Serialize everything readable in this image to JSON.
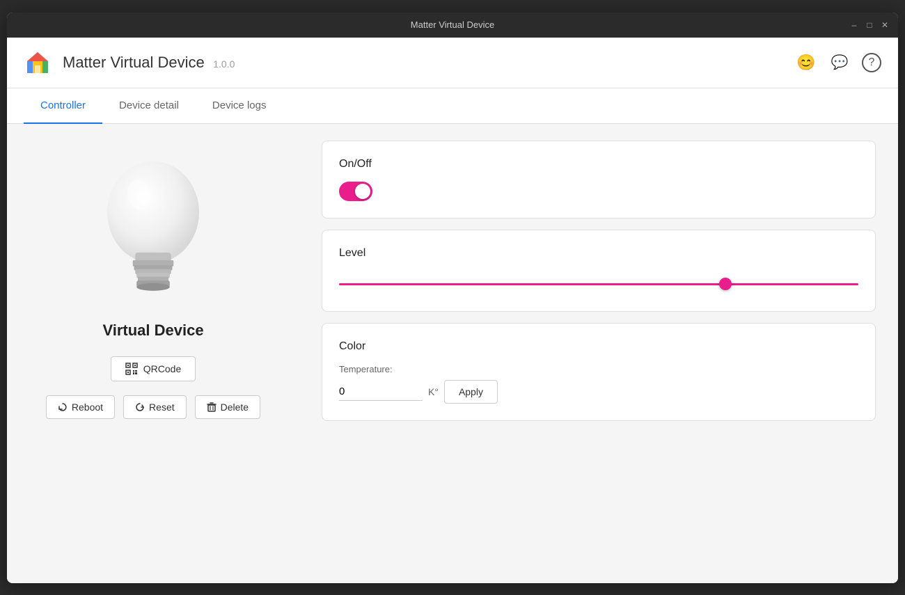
{
  "titlebar": {
    "title": "Matter Virtual Device",
    "controls": [
      "minimize",
      "maximize",
      "close"
    ]
  },
  "header": {
    "app_title": "Matter Virtual Device",
    "app_version": "1.0.0",
    "icons": [
      "smiley-icon",
      "comment-icon",
      "help-icon"
    ]
  },
  "tabs": [
    {
      "id": "controller",
      "label": "Controller",
      "active": true
    },
    {
      "id": "device-detail",
      "label": "Device detail",
      "active": false
    },
    {
      "id": "device-logs",
      "label": "Device logs",
      "active": false
    }
  ],
  "left_panel": {
    "device_name": "Virtual Device",
    "qrcode_label": "QRCode",
    "buttons": [
      {
        "id": "reboot",
        "label": "Reboot"
      },
      {
        "id": "reset",
        "label": "Reset"
      },
      {
        "id": "delete",
        "label": "Delete"
      }
    ]
  },
  "right_panel": {
    "cards": [
      {
        "id": "onoff",
        "title": "On/Off",
        "toggle_state": true
      },
      {
        "id": "level",
        "title": "Level",
        "slider_value": 75,
        "slider_min": 0,
        "slider_max": 100
      },
      {
        "id": "color",
        "title": "Color",
        "temperature_label": "Temperature:",
        "temperature_value": "0",
        "temperature_unit": "K°",
        "apply_label": "Apply"
      }
    ]
  }
}
